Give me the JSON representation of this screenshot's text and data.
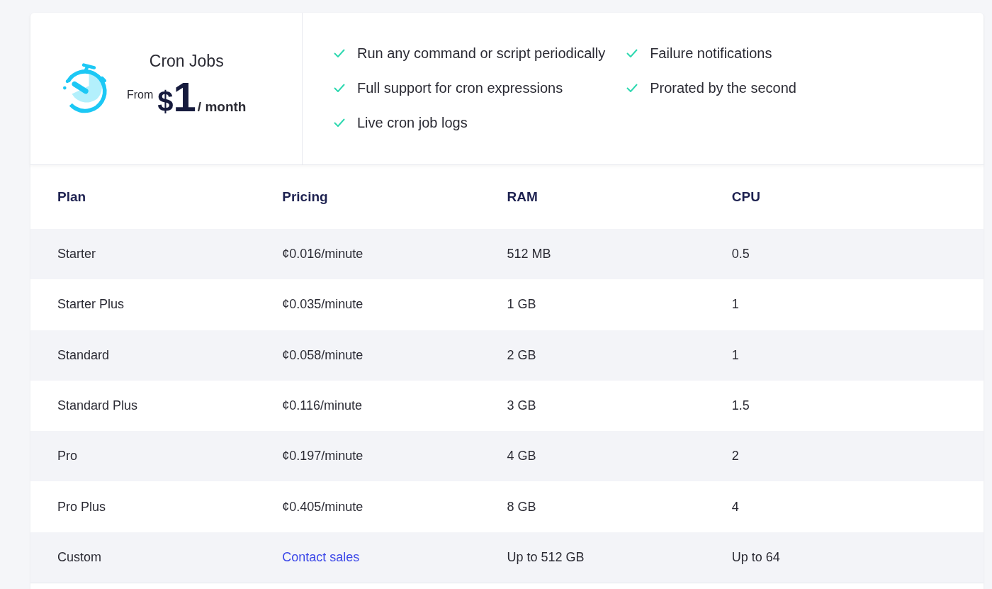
{
  "product": {
    "title": "Cron Jobs",
    "price_prefix": "From",
    "currency": "$",
    "amount": "1",
    "period": "/ month"
  },
  "features": [
    "Run any command or script periodically",
    "Full support for cron expressions",
    "Live cron job logs",
    "Failure notifications",
    "Prorated by the second"
  ],
  "table": {
    "columns": [
      "Plan",
      "Pricing",
      "RAM",
      "CPU"
    ],
    "rows": [
      {
        "cells": [
          {
            "kind": "text",
            "text": "Starter"
          },
          {
            "kind": "text",
            "text": "¢0.016/minute"
          },
          {
            "kind": "text",
            "text": "512 MB"
          },
          {
            "kind": "text",
            "text": "0.5"
          }
        ]
      },
      {
        "cells": [
          {
            "kind": "text",
            "text": "Starter Plus"
          },
          {
            "kind": "text",
            "text": "¢0.035/minute"
          },
          {
            "kind": "text",
            "text": "1 GB"
          },
          {
            "kind": "text",
            "text": "1"
          }
        ]
      },
      {
        "cells": [
          {
            "kind": "text",
            "text": "Standard"
          },
          {
            "kind": "text",
            "text": "¢0.058/minute"
          },
          {
            "kind": "text",
            "text": "2 GB"
          },
          {
            "kind": "text",
            "text": "1"
          }
        ]
      },
      {
        "cells": [
          {
            "kind": "text",
            "text": "Standard Plus"
          },
          {
            "kind": "text",
            "text": "¢0.116/minute"
          },
          {
            "kind": "text",
            "text": "3 GB"
          },
          {
            "kind": "text",
            "text": "1.5"
          }
        ]
      },
      {
        "cells": [
          {
            "kind": "text",
            "text": "Pro"
          },
          {
            "kind": "text",
            "text": "¢0.197/minute"
          },
          {
            "kind": "text",
            "text": "4 GB"
          },
          {
            "kind": "text",
            "text": "2"
          }
        ]
      },
      {
        "cells": [
          {
            "kind": "text",
            "text": "Pro Plus"
          },
          {
            "kind": "text",
            "text": "¢0.405/minute"
          },
          {
            "kind": "text",
            "text": "8 GB"
          },
          {
            "kind": "text",
            "text": "4"
          }
        ]
      },
      {
        "cells": [
          {
            "kind": "text",
            "text": "Custom"
          },
          {
            "kind": "link",
            "text": "Contact sales"
          },
          {
            "kind": "text",
            "text": "Up to 512 GB"
          },
          {
            "kind": "text",
            "text": "Up to 64"
          }
        ]
      }
    ]
  }
}
